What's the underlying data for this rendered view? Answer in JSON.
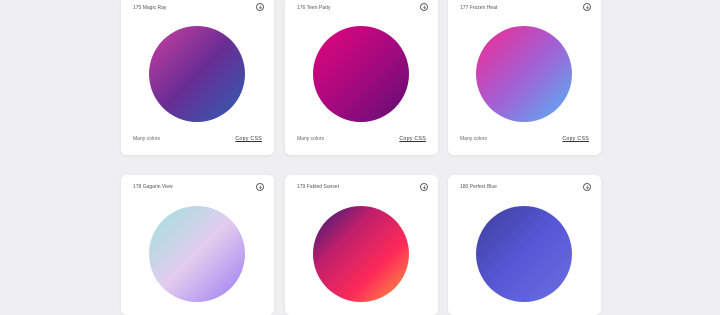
{
  "cards": [
    {
      "title": "175 Magic Ray",
      "footer": "Many colors",
      "copy_label": "Copy CSS",
      "colors": [
        "#cd3fa0",
        "#682d93",
        "#2f5fb4"
      ]
    },
    {
      "title": "176 Teen Party",
      "footer": "Many colors",
      "copy_label": "Copy CSS",
      "colors": [
        "#e4067a",
        "#a8087f",
        "#5e0f74"
      ]
    },
    {
      "title": "177 Frozen Heat",
      "footer": "Many colors",
      "copy_label": "Copy CSS",
      "colors": [
        "#f4288f",
        "#a35fd4",
        "#54b3f6"
      ]
    },
    {
      "title": "178 Gagarin View",
      "footer": "",
      "copy_label": "",
      "colors": [
        "#9de3db",
        "#e3ccef",
        "#9a7bf0"
      ]
    },
    {
      "title": "179 Fabled Sunset",
      "footer": "",
      "copy_label": "",
      "colors": [
        "#2d1a7a",
        "#c01f6b",
        "#fd2a5a",
        "#fba03b"
      ]
    },
    {
      "title": "180 Perfect Blue",
      "footer": "",
      "copy_label": "",
      "colors": [
        "#3c3f99",
        "#5857d6",
        "#6a6fe0"
      ]
    }
  ]
}
